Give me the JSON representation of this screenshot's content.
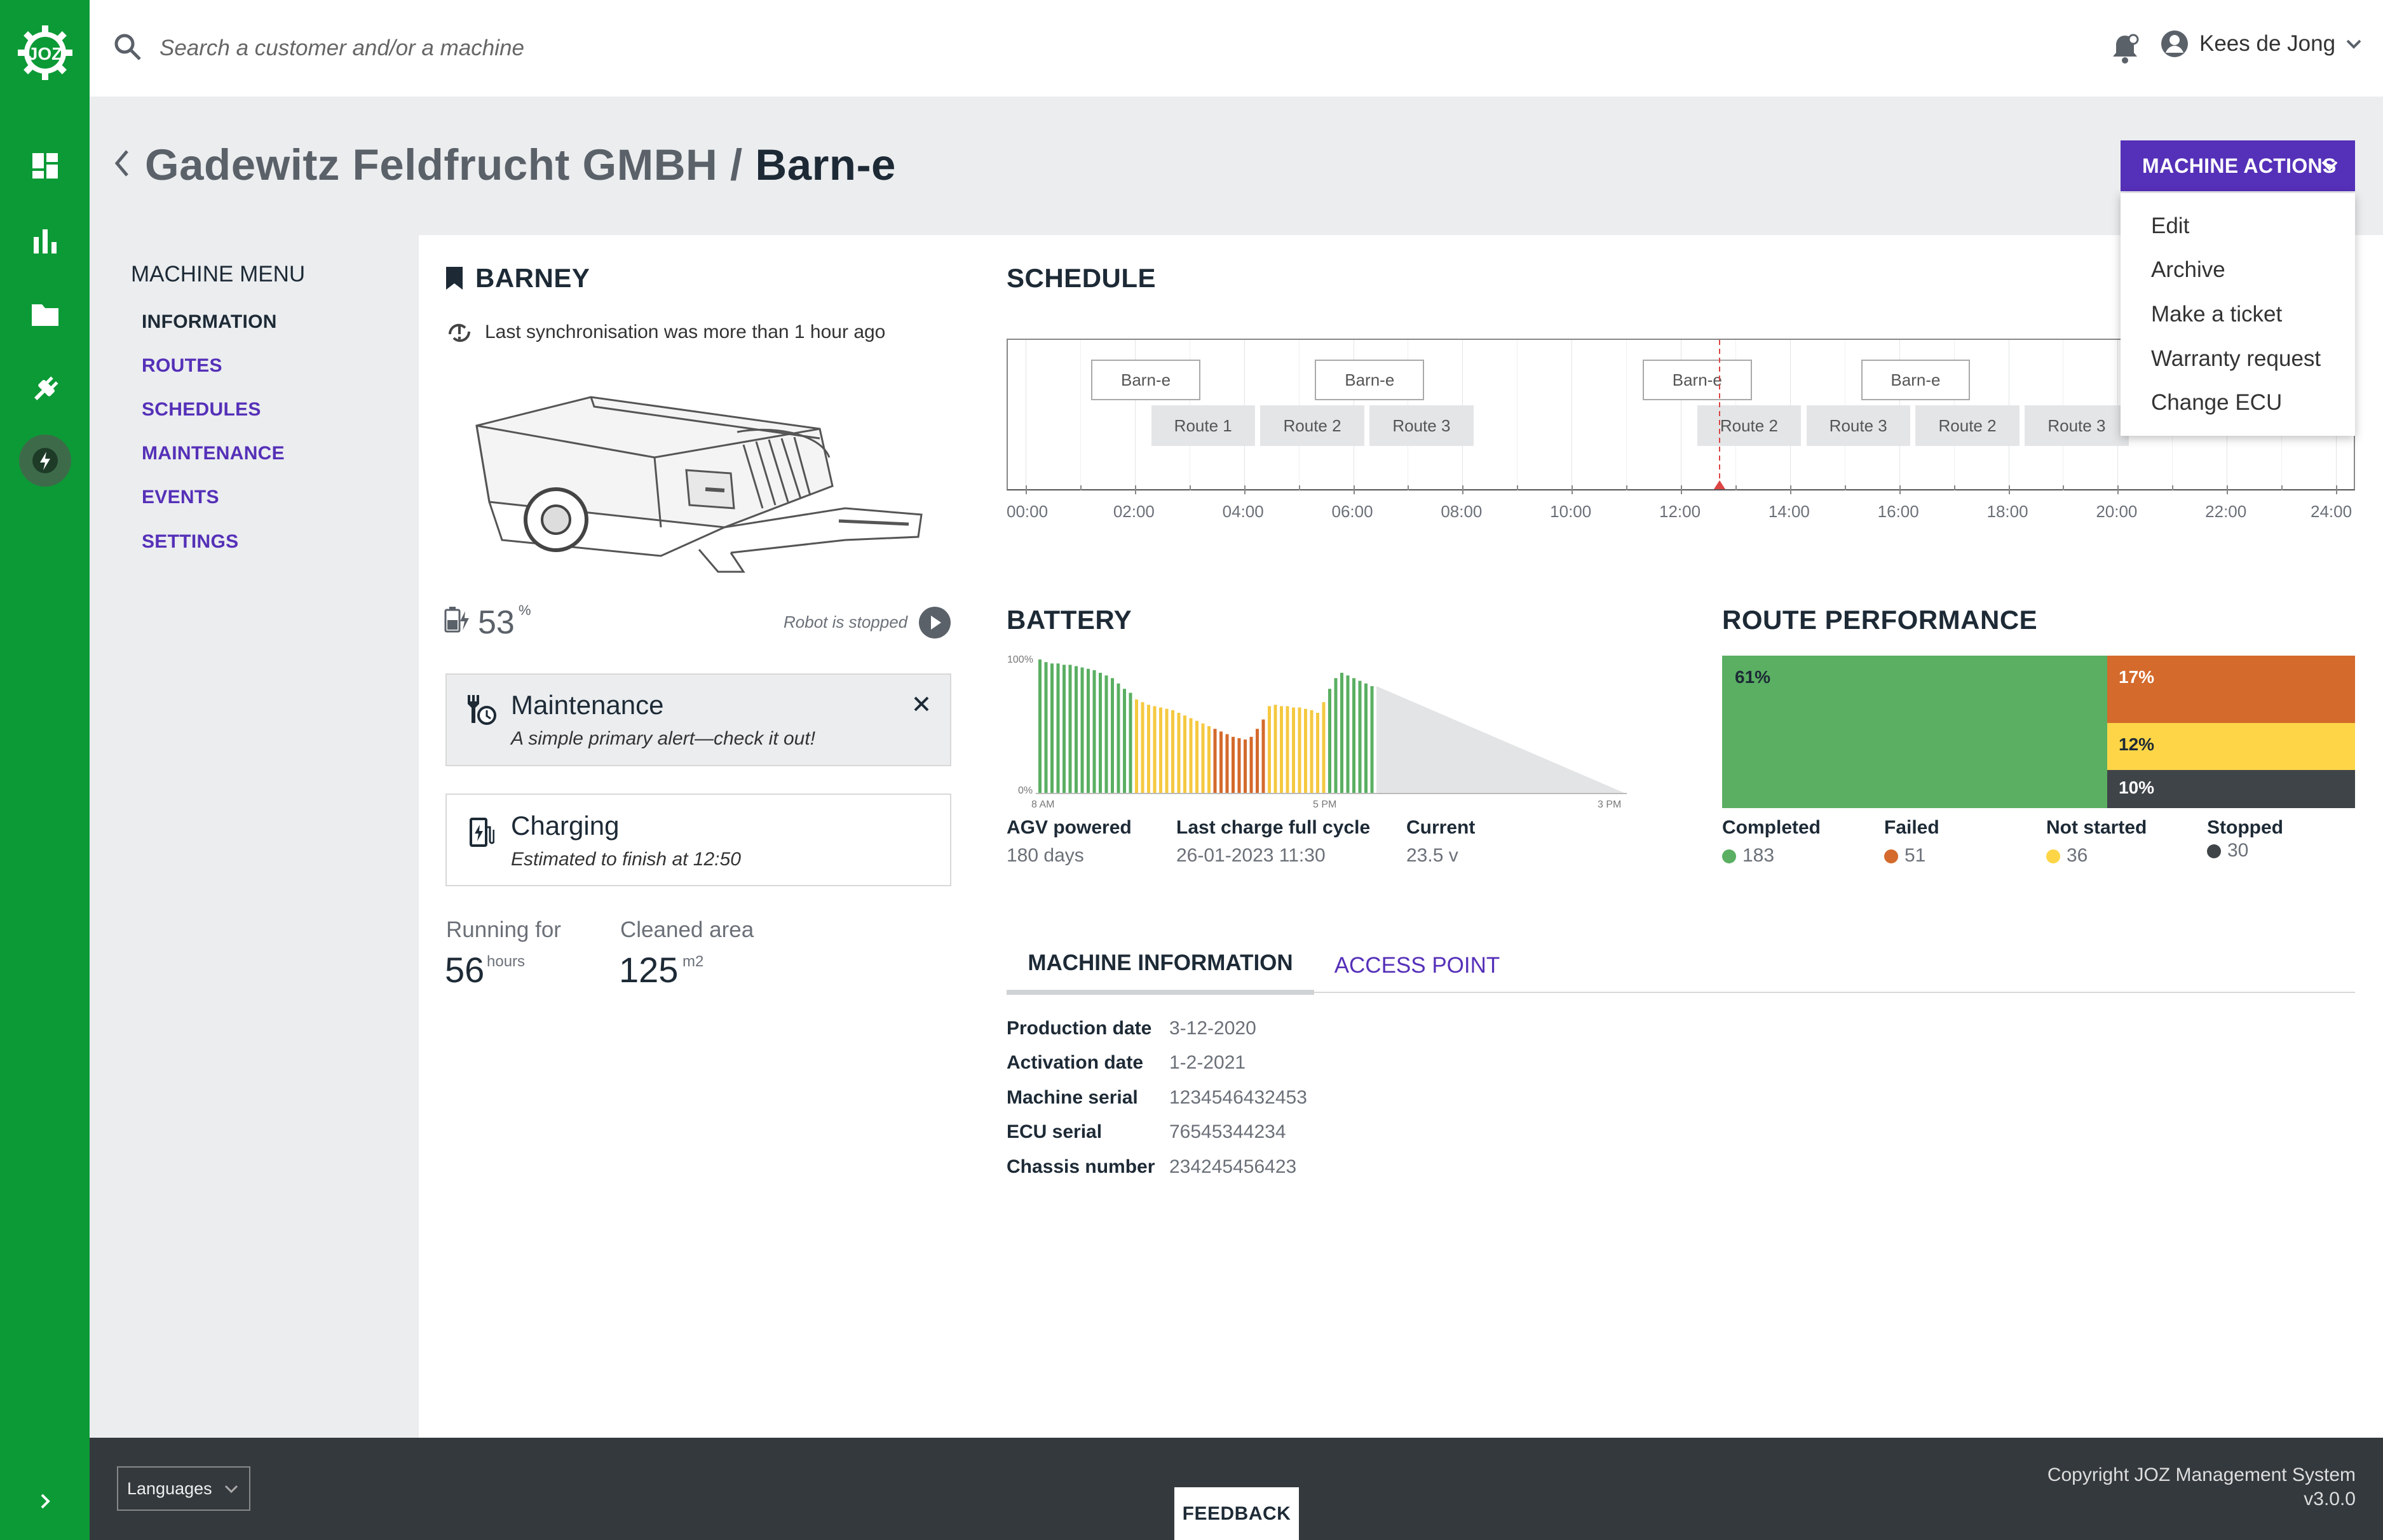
{
  "header": {
    "search_placeholder": "Search a customer and/or a machine",
    "user_name": "Kees de Jong"
  },
  "page": {
    "customer": "Gadewitz Feldfrucht GMBH",
    "separator": " / ",
    "machine": "Barn-e"
  },
  "actions": {
    "button_label": "MACHINE ACTIONS",
    "items": [
      "Edit",
      "Archive",
      "Make a ticket",
      "Warranty request",
      "Change ECU"
    ]
  },
  "machine_menu": {
    "title": "MACHINE MENU",
    "items": [
      "INFORMATION",
      "ROUTES",
      "SCHEDULES",
      "MAINTENANCE",
      "EVENTS",
      "SETTINGS"
    ],
    "active": "INFORMATION"
  },
  "robot": {
    "name": "BARNEY",
    "sync_text": "Last synchronisation was more than 1 hour ago",
    "battery_level": "53",
    "battery_unit": "%",
    "status_text": "Robot is stopped"
  },
  "alerts": {
    "maintenance": {
      "title": "Maintenance",
      "text": "A simple primary alert—check it out!"
    },
    "charging": {
      "title": "Charging",
      "text": "Estimated to finish at 12:50"
    }
  },
  "stats": {
    "running_label": "Running for",
    "running_value": "56",
    "running_unit": "hours",
    "area_label": "Cleaned area",
    "area_value": "125",
    "area_unit": "m2"
  },
  "schedule": {
    "title": "SCHEDULE",
    "ticks": [
      "00:00",
      "02:00",
      "04:00",
      "06:00",
      "08:00",
      "10:00",
      "12:00",
      "14:00",
      "16:00",
      "18:00",
      "20:00",
      "22:00",
      "24:00"
    ],
    "current_time_hours": 12.7,
    "barn_blocks": [
      {
        "label": "Barn-e",
        "start": 1.2,
        "end": 3.2
      },
      {
        "label": "Barn-e",
        "start": 5.3,
        "end": 7.3
      },
      {
        "label": "Barn-e",
        "start": 11.3,
        "end": 13.3
      },
      {
        "label": "Barn-e",
        "start": 15.3,
        "end": 17.3
      }
    ],
    "route_blocks": [
      {
        "label": "Route 1",
        "start": 2.3,
        "end": 4.2
      },
      {
        "label": "Route 2",
        "start": 4.3,
        "end": 6.2
      },
      {
        "label": "Route 3",
        "start": 6.3,
        "end": 8.2
      },
      {
        "label": "Route 2",
        "start": 12.3,
        "end": 14.2
      },
      {
        "label": "Route 3",
        "start": 14.3,
        "end": 16.2
      },
      {
        "label": "Route 2",
        "start": 16.3,
        "end": 18.2
      },
      {
        "label": "Route 3",
        "start": 18.3,
        "end": 20.2
      }
    ]
  },
  "battery": {
    "title": "BATTERY",
    "ylabels": [
      "100%",
      "0%"
    ],
    "xlabels": [
      "8 AM",
      "5 PM",
      "3 PM"
    ],
    "stats": [
      {
        "label": "AGV powered",
        "value": "180 days"
      },
      {
        "label": "Last charge full cycle",
        "value": "26-01-2023 11:30"
      },
      {
        "label": "Current",
        "value": "23.5 v"
      }
    ]
  },
  "route_performance": {
    "title": "ROUTE PERFORMANCE",
    "segments": [
      {
        "pct": "61%",
        "color": "#5aaf62"
      },
      {
        "pct": "17%",
        "color": "#d46a2c"
      },
      {
        "pct": "12%",
        "color": "#fdd547"
      },
      {
        "pct": "10%",
        "color": "#3f4448"
      }
    ],
    "legend": [
      {
        "label": "Completed",
        "count": "183",
        "color": "#5aaf62"
      },
      {
        "label": "Failed",
        "count": "51",
        "color": "#d46a2c"
      },
      {
        "label": "Not started",
        "count": "36",
        "color": "#fdd547"
      },
      {
        "label": "Stopped",
        "count": "30",
        "color": "#3f4448"
      }
    ]
  },
  "chart_data": {
    "type": "bar",
    "title": "BATTERY",
    "ylim": [
      0,
      100
    ],
    "ylabel": "",
    "xlabel": "",
    "xtick_labels": [
      "8 AM",
      "5 PM",
      "3 PM"
    ],
    "ytick_labels": [
      "100%",
      "0%"
    ],
    "values": [
      100,
      98,
      97,
      97,
      96,
      96,
      95,
      94,
      93,
      92,
      90,
      88,
      86,
      82,
      78,
      75,
      70,
      68,
      66,
      65,
      64,
      63,
      62,
      60,
      58,
      56,
      54,
      52,
      50,
      48,
      46,
      44,
      42,
      41,
      40,
      42,
      48,
      55,
      65,
      66,
      65,
      65,
      64,
      64,
      63,
      62,
      60,
      68,
      78,
      86,
      90,
      88,
      86,
      84,
      82,
      80
    ],
    "bar_colors": [
      "#5aaf62",
      "#5aaf62",
      "#5aaf62",
      "#5aaf62",
      "#5aaf62",
      "#5aaf62",
      "#5aaf62",
      "#5aaf62",
      "#5aaf62",
      "#5aaf62",
      "#5aaf62",
      "#5aaf62",
      "#5aaf62",
      "#5aaf62",
      "#5aaf62",
      "#5aaf62",
      "#f5c940",
      "#f5c940",
      "#f5c940",
      "#f5c940",
      "#f5c940",
      "#f5c940",
      "#f5c940",
      "#f5c940",
      "#f5c940",
      "#f5c940",
      "#f5c940",
      "#f5c940",
      "#f5c940",
      "#d46a2c",
      "#d46a2c",
      "#d46a2c",
      "#d46a2c",
      "#d46a2c",
      "#d46a2c",
      "#d46a2c",
      "#d46a2c",
      "#d46a2c",
      "#f5c940",
      "#f5c940",
      "#f5c940",
      "#f5c940",
      "#f5c940",
      "#f5c940",
      "#f5c940",
      "#f5c940",
      "#f5c940",
      "#f5c940",
      "#5aaf62",
      "#5aaf62",
      "#5aaf62",
      "#5aaf62",
      "#5aaf62",
      "#5aaf62",
      "#5aaf62",
      "#5aaf62"
    ],
    "forecast_end_value": 0
  },
  "tabs": {
    "items": [
      "MACHINE INFORMATION",
      "ACCESS POINT"
    ],
    "active": "MACHINE INFORMATION"
  },
  "machine_info": [
    {
      "label": "Production date",
      "value": "3-12-2020"
    },
    {
      "label": "Activation date",
      "value": "1-2-2021"
    },
    {
      "label": "Machine serial",
      "value": "1234546432453"
    },
    {
      "label": "ECU serial",
      "value": "76545344234"
    },
    {
      "label": "Chassis number",
      "value": "234245456423"
    }
  ],
  "footer": {
    "languages_label": "Languages",
    "feedback_label": "FEEDBACK",
    "copyright": "Copyright JOZ Management System",
    "version": "v3.0.0"
  },
  "colors": {
    "sidebar": "#0c9a36",
    "accent": "#5530b8",
    "footer": "#34393d"
  }
}
